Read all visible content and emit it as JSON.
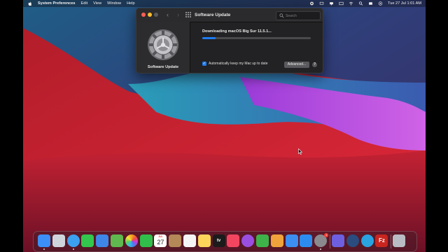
{
  "menubar": {
    "apple": "apple-icon",
    "items": [
      "System Preferences",
      "Edit",
      "View",
      "Window",
      "Help"
    ],
    "clock": "Tue 27 Jul  1:01 AM",
    "status_icons": [
      "control-center-icon",
      "cast-icon",
      "display-icon",
      "keyboard-icon",
      "wifi-icon",
      "spotlight-icon",
      "siri-icon",
      "battery-icon",
      "notification-icon"
    ]
  },
  "window": {
    "title": "Software Update",
    "search_placeholder": "Search",
    "side_label": "Software Update",
    "download_text": "Downloading macOS Big Sur 11.5.1...",
    "progress": 0.12,
    "auto_update_label": "Automatically keep my Mac up to date",
    "auto_update_checked": true,
    "advanced_label": "Advanced...",
    "help_label": "?"
  },
  "dock": {
    "items": [
      {
        "name": "finder",
        "color": "#3b8ff6",
        "running": true
      },
      {
        "name": "launchpad",
        "color": "#cfd4db",
        "running": false
      },
      {
        "name": "safari",
        "color": "#3ba0ef",
        "running": true
      },
      {
        "name": "messages",
        "color": "#33c74d",
        "running": false
      },
      {
        "name": "mail",
        "color": "#3e86e8",
        "running": false
      },
      {
        "name": "maps",
        "color": "#5fb94f",
        "running": false
      },
      {
        "name": "photos",
        "color": "#f4f4f4",
        "running": false
      },
      {
        "name": "facetime",
        "color": "#2fbf4a",
        "running": false
      },
      {
        "name": "calendar",
        "color": "#ffffff",
        "running": false
      },
      {
        "name": "contacts",
        "color": "#b48857",
        "running": false
      },
      {
        "name": "reminders",
        "color": "#f5f5f5",
        "running": false
      },
      {
        "name": "notes",
        "color": "#fbd55a",
        "running": false
      },
      {
        "name": "apple-tv",
        "color": "#1b1b1b",
        "running": false
      },
      {
        "name": "music",
        "color": "#f24660",
        "running": false
      },
      {
        "name": "podcasts",
        "color": "#9b4fe0",
        "running": false
      },
      {
        "name": "numbers",
        "color": "#3eb34a",
        "running": false
      },
      {
        "name": "pages",
        "color": "#f0a33a",
        "running": false
      },
      {
        "name": "keynote",
        "color": "#3c8ef0",
        "running": false
      },
      {
        "name": "app-store",
        "color": "#2d8cf0",
        "running": false
      },
      {
        "name": "system-preferences",
        "color": "#8a8a8e",
        "running": true
      },
      {
        "name": "imovie",
        "color": "#6d5fe0",
        "running": false
      },
      {
        "name": "quicktime",
        "color": "#2b4c7e",
        "running": false
      },
      {
        "name": "telegram",
        "color": "#2aa3e0",
        "running": false
      },
      {
        "name": "filezilla",
        "color": "#c8251f",
        "running": false
      },
      {
        "name": "trash",
        "color": "#b9bcc2",
        "running": false
      }
    ],
    "calendar": {
      "month": "JUL",
      "day": "27"
    },
    "tv_label": "tv",
    "filezilla_label": "Fz",
    "preferences_badge": "1"
  }
}
